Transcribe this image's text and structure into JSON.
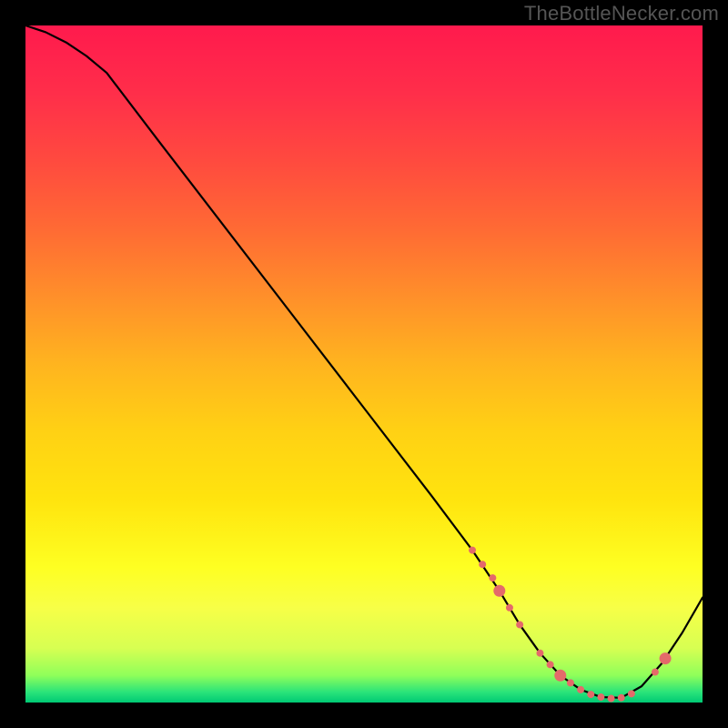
{
  "watermark": "TheBottleNecker.com",
  "chart_data": {
    "type": "line",
    "title": "",
    "xlabel": "",
    "ylabel": "",
    "xlim": [
      0,
      100
    ],
    "ylim": [
      0,
      100
    ],
    "background_gradient": {
      "stops": [
        {
          "offset": 0.0,
          "color": "#ff1a4d"
        },
        {
          "offset": 0.1,
          "color": "#ff2e4a"
        },
        {
          "offset": 0.2,
          "color": "#ff4a3f"
        },
        {
          "offset": 0.3,
          "color": "#ff6a34"
        },
        {
          "offset": 0.4,
          "color": "#ff8f2a"
        },
        {
          "offset": 0.5,
          "color": "#ffb41f"
        },
        {
          "offset": 0.6,
          "color": "#ffd114"
        },
        {
          "offset": 0.7,
          "color": "#ffe40e"
        },
        {
          "offset": 0.8,
          "color": "#feff22"
        },
        {
          "offset": 0.86,
          "color": "#f7ff47"
        },
        {
          "offset": 0.92,
          "color": "#d7ff52"
        },
        {
          "offset": 0.96,
          "color": "#8fff5a"
        },
        {
          "offset": 0.985,
          "color": "#29e37a"
        },
        {
          "offset": 1.0,
          "color": "#00c974"
        }
      ]
    },
    "series": [
      {
        "name": "bottleneck-curve",
        "color": "#000000",
        "x": [
          0,
          3,
          6,
          9,
          12,
          20,
          30,
          40,
          50,
          60,
          66,
          70,
          73,
          76,
          79,
          82,
          85,
          88,
          91,
          94,
          97,
          100
        ],
        "y": [
          100,
          99,
          97.5,
          95.5,
          93,
          82.5,
          69.5,
          56.5,
          43.5,
          30.5,
          22.5,
          16.5,
          11.5,
          7.3,
          4.0,
          1.9,
          0.8,
          0.7,
          2.4,
          5.8,
          10.3,
          15.5
        ]
      }
    ],
    "markers": {
      "name": "bottleneck-markers",
      "color": "#e46a6a",
      "radius_small": 4.0,
      "radius_large": 6.5,
      "points": [
        {
          "x": 66.0,
          "y": 22.5,
          "r": "small"
        },
        {
          "x": 67.5,
          "y": 20.4,
          "r": "small"
        },
        {
          "x": 69.0,
          "y": 18.4,
          "r": "small"
        },
        {
          "x": 70.0,
          "y": 16.5,
          "r": "large"
        },
        {
          "x": 71.5,
          "y": 14.0,
          "r": "small"
        },
        {
          "x": 73.0,
          "y": 11.5,
          "r": "small"
        },
        {
          "x": 76.0,
          "y": 7.3,
          "r": "small"
        },
        {
          "x": 77.5,
          "y": 5.6,
          "r": "small"
        },
        {
          "x": 79.0,
          "y": 4.0,
          "r": "large"
        },
        {
          "x": 80.5,
          "y": 2.9,
          "r": "small"
        },
        {
          "x": 82.0,
          "y": 1.9,
          "r": "small"
        },
        {
          "x": 83.5,
          "y": 1.2,
          "r": "small"
        },
        {
          "x": 85.0,
          "y": 0.8,
          "r": "small"
        },
        {
          "x": 86.5,
          "y": 0.6,
          "r": "small"
        },
        {
          "x": 88.0,
          "y": 0.7,
          "r": "small"
        },
        {
          "x": 89.5,
          "y": 1.3,
          "r": "small"
        },
        {
          "x": 93.0,
          "y": 4.5,
          "r": "small"
        },
        {
          "x": 94.5,
          "y": 6.5,
          "r": "large"
        }
      ]
    }
  }
}
